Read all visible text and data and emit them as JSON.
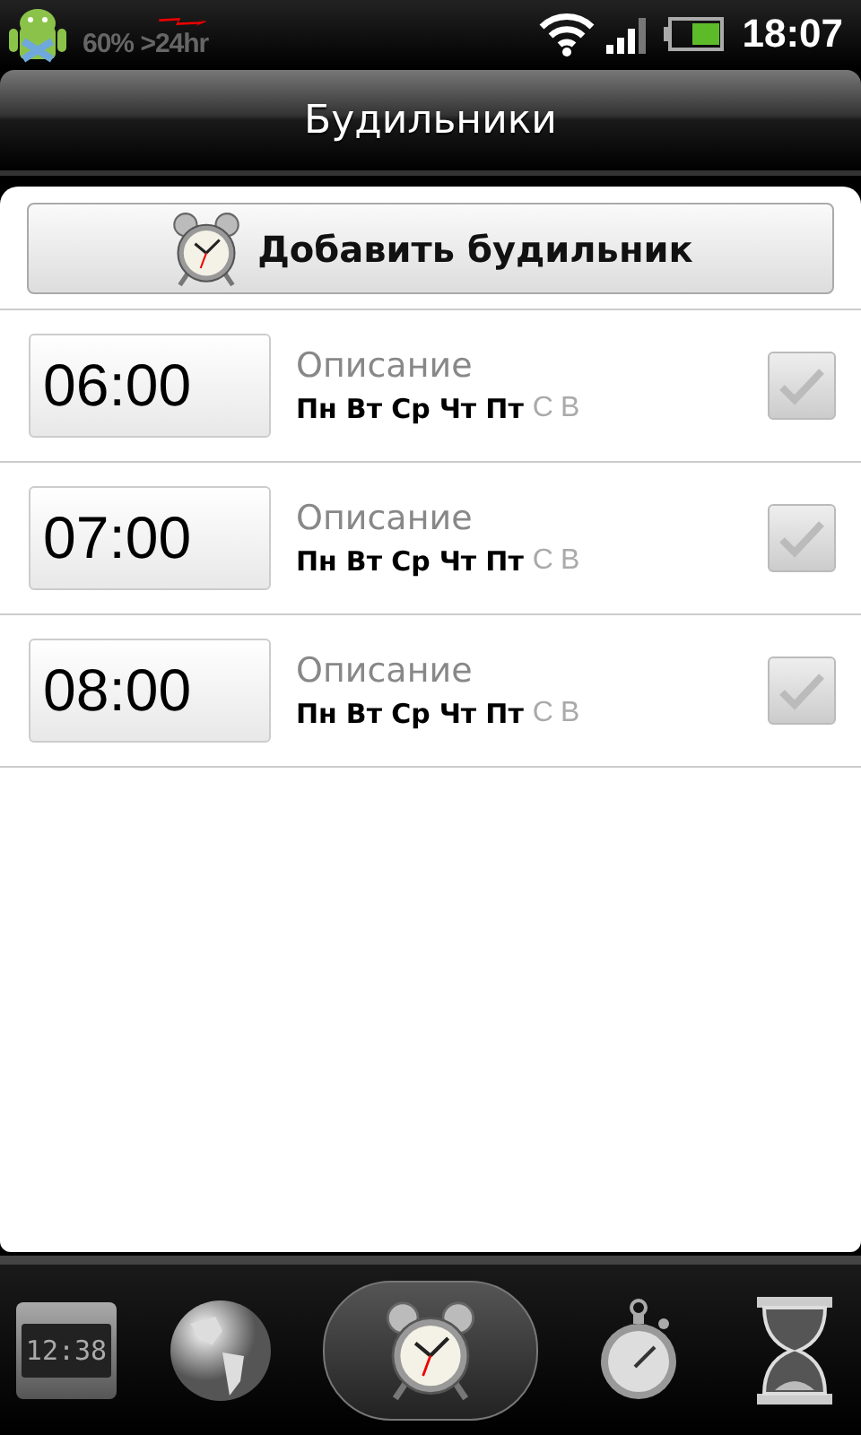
{
  "status_bar": {
    "battery_text": "60% >24hr",
    "time": "18:07"
  },
  "title": "Будильники",
  "add_button": {
    "label": "Добавить будильник"
  },
  "alarms": [
    {
      "time": "06:00",
      "description": "Описание",
      "checked": false,
      "days": [
        {
          "label": "Пн",
          "on": true
        },
        {
          "label": "Вт",
          "on": true
        },
        {
          "label": "Ср",
          "on": true
        },
        {
          "label": "Чт",
          "on": true
        },
        {
          "label": "Пт",
          "on": true
        },
        {
          "label": "С",
          "on": false
        },
        {
          "label": "В",
          "on": false
        }
      ]
    },
    {
      "time": "07:00",
      "description": "Описание",
      "checked": false,
      "days": [
        {
          "label": "Пн",
          "on": true
        },
        {
          "label": "Вт",
          "on": true
        },
        {
          "label": "Ср",
          "on": true
        },
        {
          "label": "Чт",
          "on": true
        },
        {
          "label": "Пт",
          "on": true
        },
        {
          "label": "С",
          "on": false
        },
        {
          "label": "В",
          "on": false
        }
      ]
    },
    {
      "time": "08:00",
      "description": "Описание",
      "checked": false,
      "days": [
        {
          "label": "Пн",
          "on": true
        },
        {
          "label": "Вт",
          "on": true
        },
        {
          "label": "Ср",
          "on": true
        },
        {
          "label": "Чт",
          "on": true
        },
        {
          "label": "Пт",
          "on": true
        },
        {
          "label": "С",
          "on": false
        },
        {
          "label": "В",
          "on": false
        }
      ]
    }
  ],
  "tabs": [
    {
      "kind": "desk-clock",
      "display": "12:38",
      "selected": false
    },
    {
      "kind": "world-clock",
      "selected": false
    },
    {
      "kind": "alarm",
      "selected": true
    },
    {
      "kind": "stopwatch",
      "selected": false
    },
    {
      "kind": "timer",
      "selected": false
    }
  ]
}
